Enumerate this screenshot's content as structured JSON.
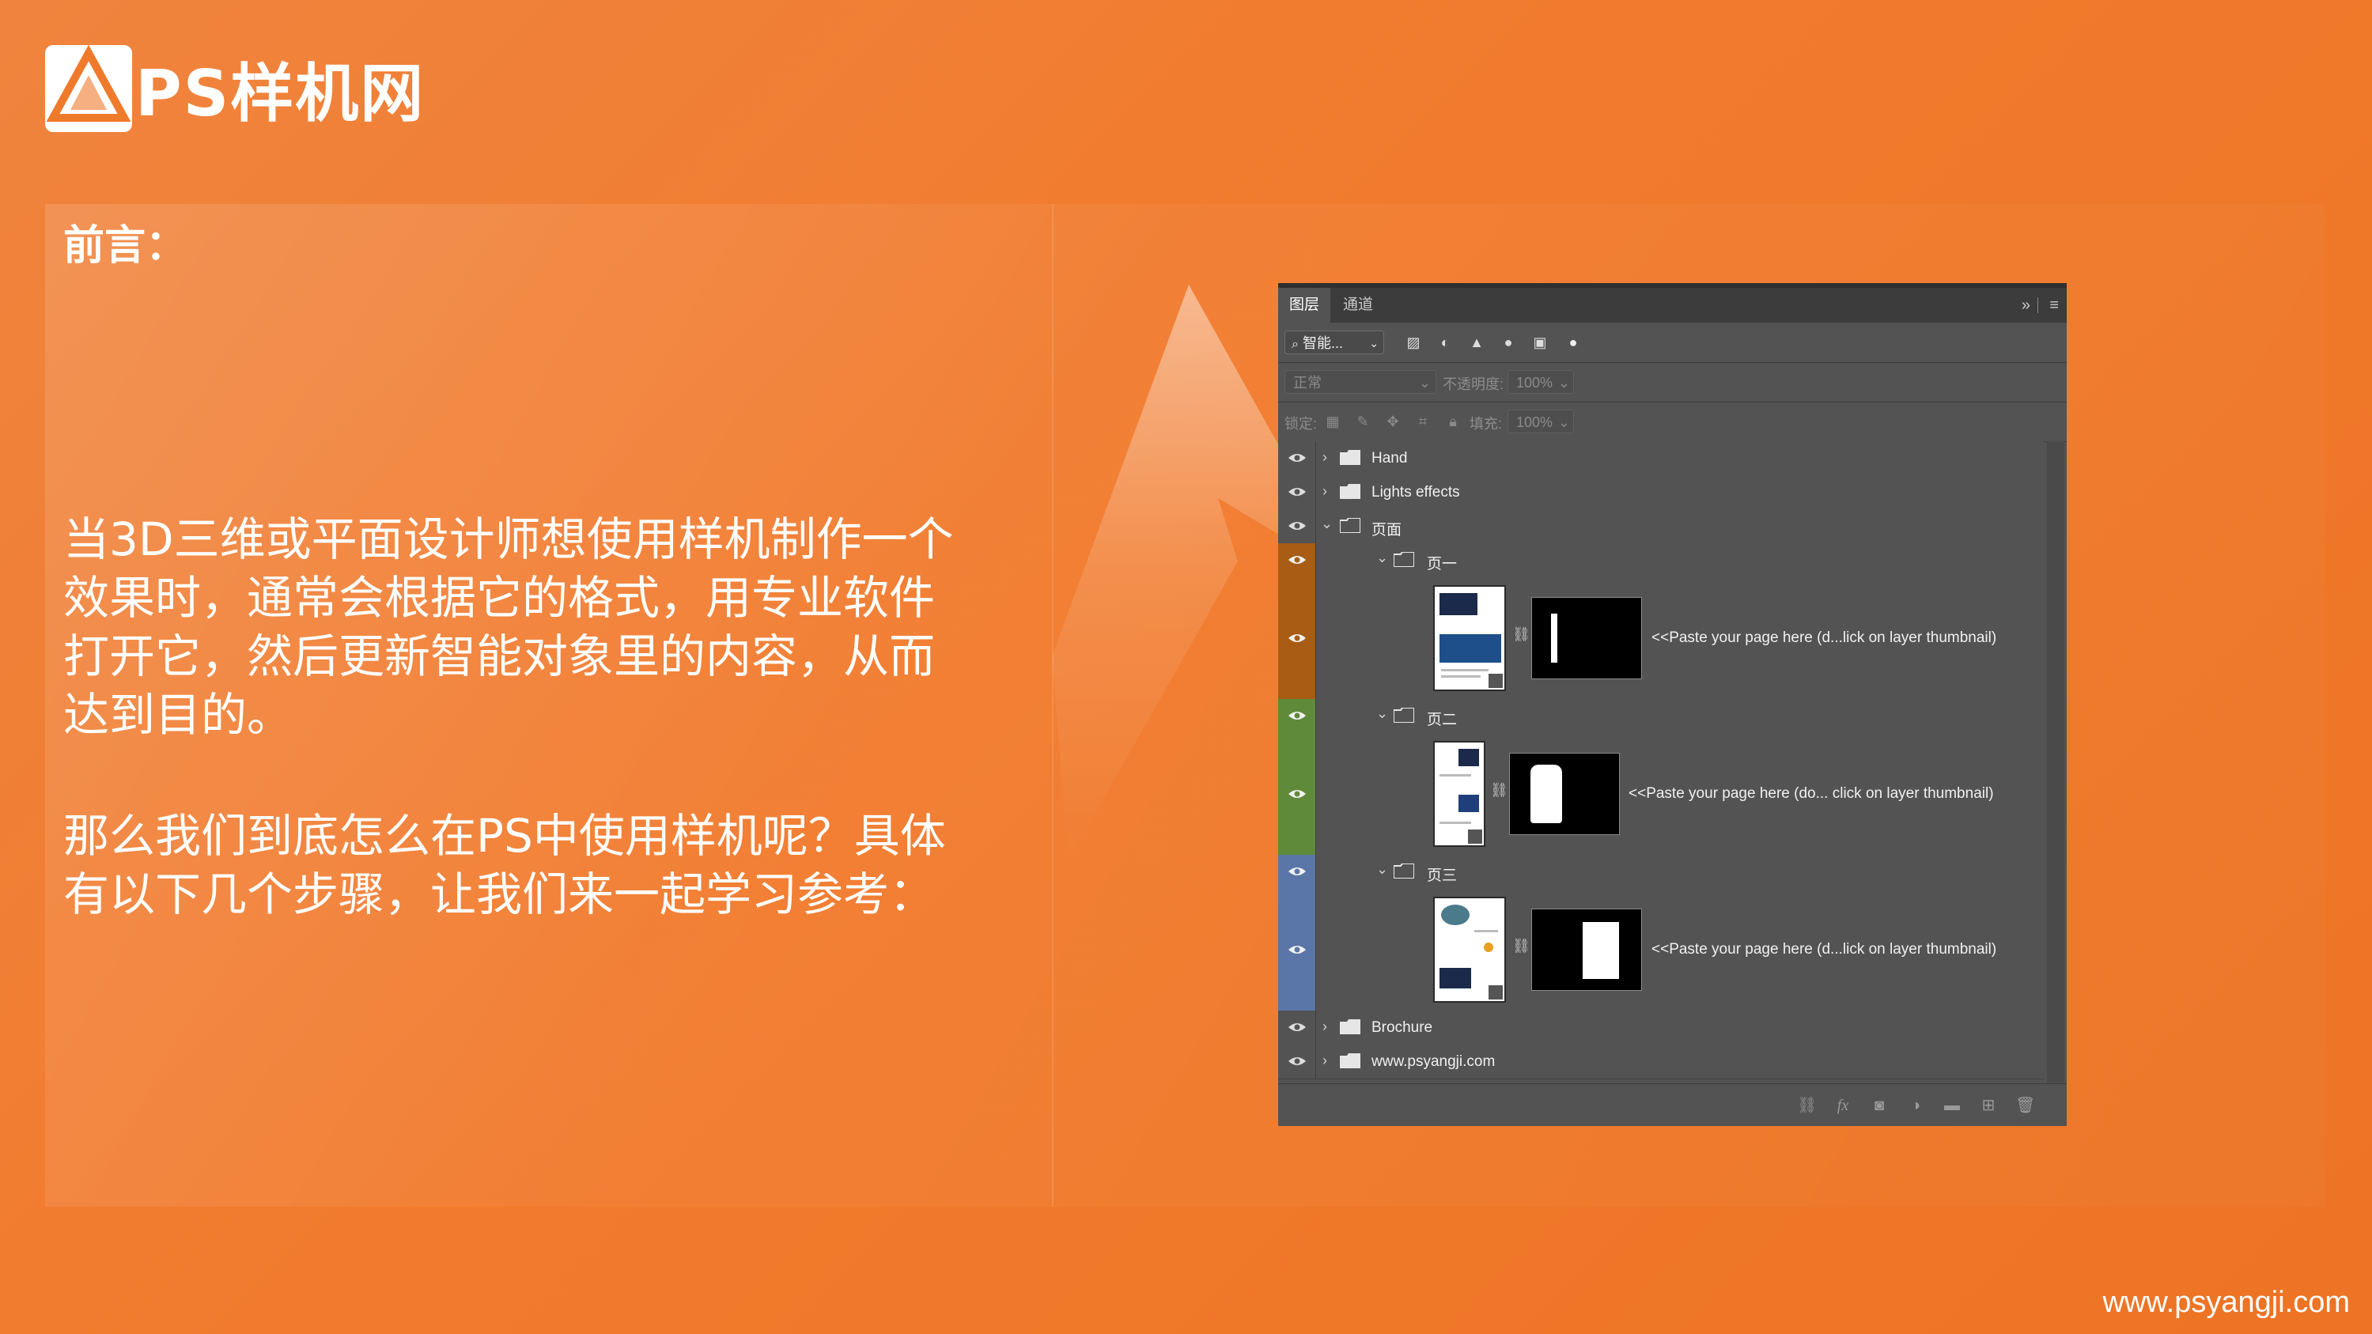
{
  "brand": {
    "logo_text": "PS样机网"
  },
  "intro": {
    "title": "前言：",
    "para1": "当3D三维或平面设计师想使用样机制作一个效果时，通常会根据它的格式，用专业软件打开它，然后更新智能对象里的内容，从而达到目的。",
    "para2": "那么我们到底怎么在PS中使用样机呢？具体有以下几个步骤，让我们来一起学习参考："
  },
  "footer": {
    "url": "www.psyangji.com"
  },
  "ps_panel": {
    "tabs": [
      {
        "label": "图层",
        "active": true
      },
      {
        "label": "通道",
        "active": false
      }
    ],
    "filter": {
      "value": "智能...",
      "icons": [
        "image-filter-icon",
        "adjustment-filter-icon",
        "type-filter-icon",
        "shape-filter-icon",
        "smart-object-filter-icon",
        "filter-toggle-icon"
      ]
    },
    "blend_mode": "正常",
    "opacity_label": "不透明度:",
    "opacity_value": "100%",
    "lock_label": "锁定:",
    "fill_label": "填充:",
    "fill_value": "100%",
    "layers": [
      {
        "name": "Hand",
        "type": "group",
        "expanded": false
      },
      {
        "name": "Lights effects",
        "type": "group",
        "expanded": false
      },
      {
        "name": "页面",
        "type": "group",
        "expanded": true
      },
      {
        "name": "页一",
        "type": "group",
        "expanded": true,
        "color": "#a85c14"
      },
      {
        "name": "<<Paste your page here (d...lick on layer thumbnail)",
        "type": "smart-object",
        "color": "#a85c14"
      },
      {
        "name": "页二",
        "type": "group",
        "expanded": true,
        "color": "#5f8a3a"
      },
      {
        "name": "<<Paste your page here (do... click on layer thumbnail)",
        "type": "smart-object",
        "color": "#5f8a3a"
      },
      {
        "name": "页三",
        "type": "group",
        "expanded": true,
        "color": "#5a76a8"
      },
      {
        "name": "<<Paste your page here (d...lick on layer thumbnail)",
        "type": "smart-object",
        "color": "#5a76a8"
      },
      {
        "name": "Brochure",
        "type": "group",
        "expanded": false
      },
      {
        "name": "www.psyangji.com",
        "type": "group",
        "expanded": false
      }
    ],
    "bottom_icons": [
      "link-layers-icon",
      "fx-icon",
      "add-mask-icon",
      "adjustment-layer-icon",
      "new-group-icon",
      "new-layer-icon",
      "delete-layer-icon"
    ]
  }
}
